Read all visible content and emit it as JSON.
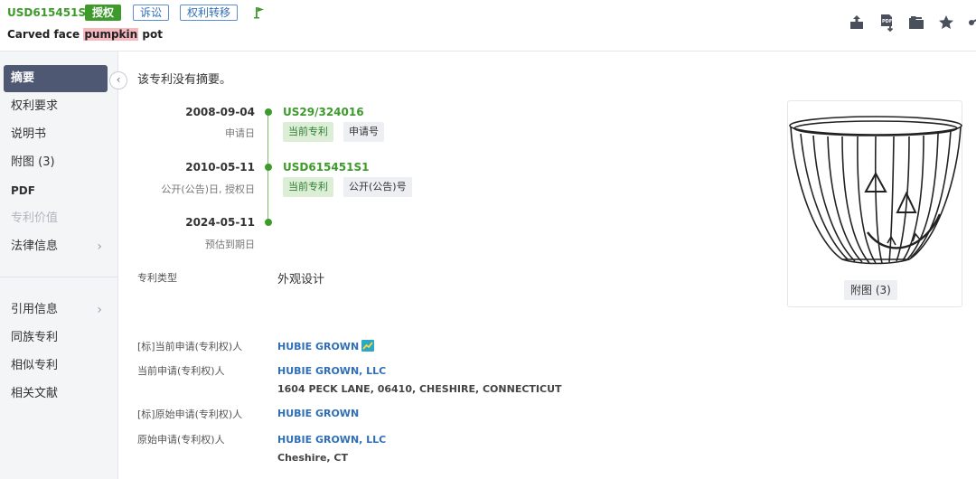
{
  "header": {
    "patent_number": "USD615451S1",
    "badges": {
      "grant": "授权",
      "litigation": "诉讼",
      "transfer": "权利转移"
    },
    "title_prefix": "Carved face ",
    "title_highlight": "pumpkin",
    "title_suffix": " pot",
    "icons": [
      "flag-icon",
      "share-export-icon",
      "pdf-download-icon",
      "folder-icon",
      "star-icon",
      "share-icon"
    ]
  },
  "sidebar": {
    "items": [
      {
        "label": "摘要"
      },
      {
        "label": "权利要求"
      },
      {
        "label": "说明书"
      },
      {
        "label": "附图 (3)"
      },
      {
        "label": "PDF"
      },
      {
        "label": "专利价值"
      },
      {
        "label": "法律信息"
      },
      {
        "label": "引用信息"
      },
      {
        "label": "同族专利"
      },
      {
        "label": "相似专利"
      },
      {
        "label": "相关文献"
      }
    ]
  },
  "main": {
    "abstract_text": "该专利没有摘要。",
    "timeline": [
      {
        "date": "2008-09-04",
        "label": "申请日",
        "number": "US29/324016",
        "tags": [
          "当前专利",
          "申请号"
        ]
      },
      {
        "date": "2010-05-11",
        "label": "公开(公告)日, 授权日",
        "number": "USD615451S1",
        "tags": [
          "当前专利",
          "公开(公告)号"
        ]
      },
      {
        "date": "2024-05-11",
        "label": "预估到期日"
      }
    ],
    "patent_type": {
      "label": "专利类型",
      "value": "外观设计"
    },
    "assignees": [
      {
        "label": "[标]当前申请(专利权)人",
        "name": "HUBIE GROWN"
      },
      {
        "label": "当前申请(专利权)人",
        "name": "HUBIE GROWN, LLC",
        "address": "1604 PECK LANE, 06410, CHESHIRE, CONNECTICUT"
      },
      {
        "label": "[标]原始申请(专利权)人",
        "name": "HUBIE GROWN"
      },
      {
        "label": "原始申请(专利权)人",
        "name": "HUBIE GROWN, LLC",
        "address": "Cheshire, CT"
      }
    ]
  },
  "drawing": {
    "button_label": "附图 (3)"
  },
  "colors": {
    "green": "#3d9a2b",
    "blue": "#2f6fb8",
    "nav_active": "#4e5873"
  }
}
